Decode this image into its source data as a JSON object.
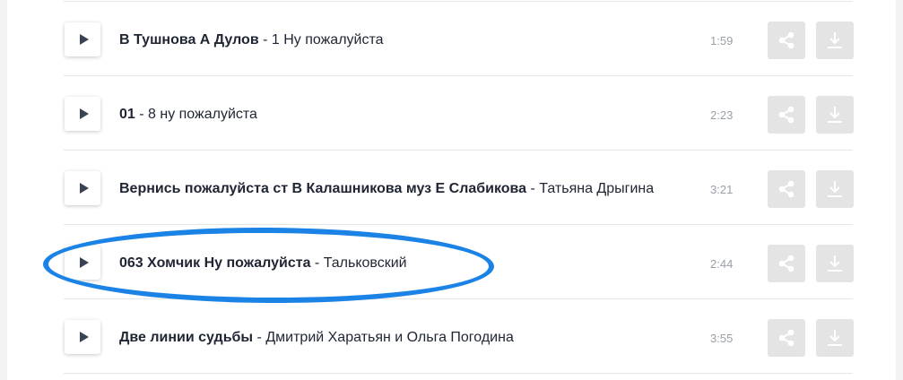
{
  "tracks": [
    {
      "title": "В Тушнова А Дулов",
      "dash": " - ",
      "artist": "1 Ну пожалуйста",
      "duration": "1:59"
    },
    {
      "title": "01",
      "dash": " - ",
      "artist": "8 ну пожалуйста",
      "duration": "2:23"
    },
    {
      "title": "Вернись пожалуйста ст В Калашникова муз Е Слабикова",
      "dash": " - ",
      "artist": "Татьяна Дрыгина",
      "duration": "3:21"
    },
    {
      "title": "063 Хомчик Ну пожалуйста",
      "dash": " - ",
      "artist": "Тальковский",
      "duration": "2:44"
    },
    {
      "title": "Две линии судьбы",
      "dash": " - ",
      "artist": "Дмитрий Харатьян и Ольга Погодина",
      "duration": "3:55"
    }
  ],
  "icons": {
    "play": "play-icon",
    "share": "share-icon",
    "download": "download-icon"
  },
  "colors": {
    "accent_highlight": "#1b83e6",
    "button_bg": "#e4e4e4",
    "text": "#1f2533",
    "muted": "#9aa0a8"
  }
}
